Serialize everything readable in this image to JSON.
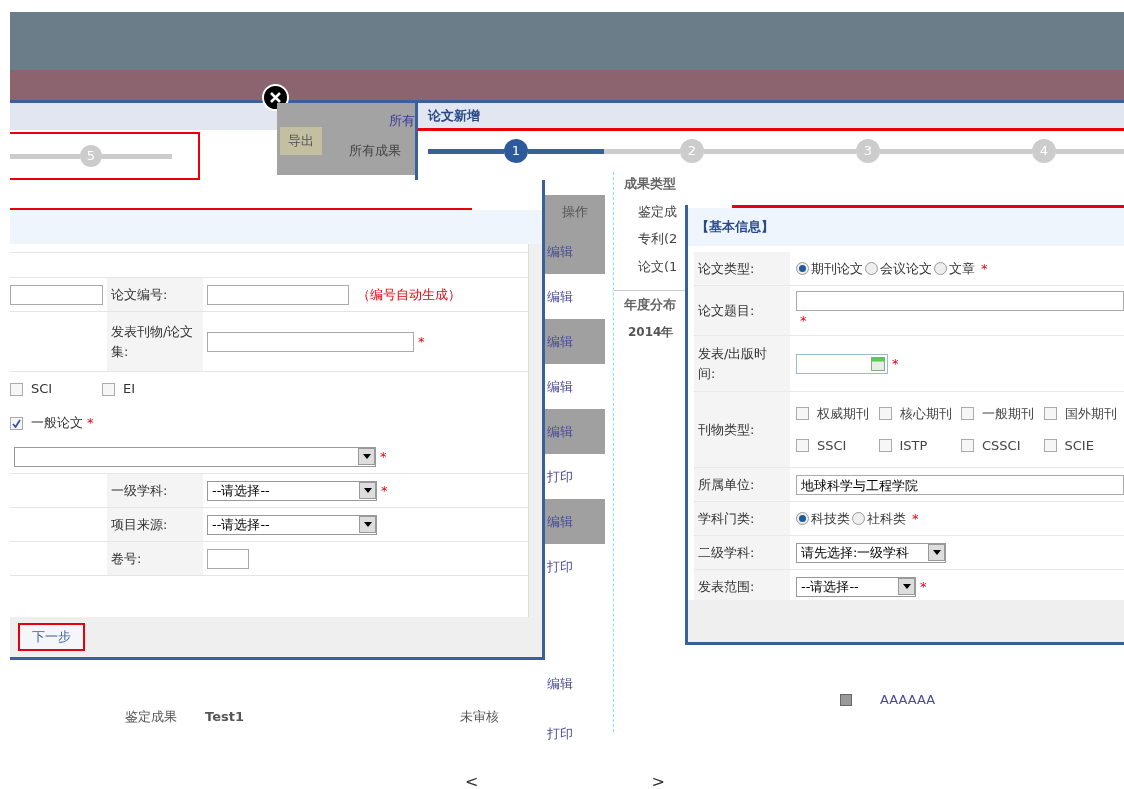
{
  "results_page": {
    "export_button": "导出",
    "filter_all": "所有成果",
    "filter_all_cut": "所有",
    "actions_header": "操作",
    "action_links": [
      "编辑",
      "编辑",
      "编辑",
      "编辑",
      "编辑",
      "打印",
      "编辑",
      "打印"
    ],
    "type_panel": {
      "title": "成果类型",
      "items": [
        "鉴定成",
        "专利(2",
        "论文(1"
      ]
    },
    "year_panel": {
      "title": "年度分布",
      "items": [
        "2014年"
      ]
    },
    "bottom_row": {
      "type": "鉴定成果",
      "name": "Test1",
      "status": "未审核",
      "links": [
        "编辑",
        "打印"
      ]
    },
    "bottom_right": {
      "text": "AAAAAA"
    }
  },
  "left_dialog": {
    "step": {
      "number": "5"
    },
    "rows": [
      {
        "kind": "input_note",
        "label": "论文编号:",
        "note": "（编号自动生成）"
      },
      {
        "kind": "input",
        "label": "发表刊物/论文集:",
        "required": "*"
      },
      {
        "kind": "checks",
        "items": [
          {
            "label": "SCI",
            "checked": false
          },
          {
            "label": "EI",
            "checked": false
          }
        ]
      },
      {
        "kind": "checks",
        "items": [
          {
            "label": "一般论文",
            "checked": true
          }
        ],
        "required": "*"
      },
      {
        "kind": "select",
        "value": "",
        "required": "*"
      },
      {
        "kind": "select",
        "label": "一级学科:",
        "value": "--请选择--",
        "required": "*"
      },
      {
        "kind": "select",
        "label": "项目来源:",
        "value": "--请选择--"
      },
      {
        "kind": "input",
        "label": "卷号:"
      }
    ],
    "next_button": "下一步"
  },
  "right_dialog": {
    "title": "论文新增",
    "steps": [
      {
        "number": "1",
        "selected": true
      },
      {
        "number": "2",
        "selected": false
      },
      {
        "number": "3",
        "selected": false
      },
      {
        "number": "4",
        "selected": false
      }
    ]
  },
  "basic_info_form": {
    "section": "【基本信息】",
    "rows": [
      {
        "kind": "radios",
        "label": "论文类型:",
        "required": "*",
        "options": [
          {
            "label": "期刊论文",
            "selected": true
          },
          {
            "label": "会议论文",
            "selected": false
          },
          {
            "label": "文章",
            "selected": false
          }
        ]
      },
      {
        "kind": "text",
        "label": "论文题目:",
        "required": "*"
      },
      {
        "kind": "date",
        "label": "发表/出版时间:",
        "required": "*"
      },
      {
        "kind": "checks",
        "label": "刊物类型:",
        "items": [
          {
            "label": "权威期刊",
            "checked": false
          },
          {
            "label": "核心期刊",
            "checked": false
          },
          {
            "label": "一般期刊",
            "checked": false
          },
          {
            "label": "国外期刊",
            "checked": false
          },
          {
            "label": "SSCI",
            "checked": false
          },
          {
            "label": "ISTP",
            "checked": false
          },
          {
            "label": "CSSCI",
            "checked": false
          },
          {
            "label": "SCIE",
            "checked": false
          }
        ]
      },
      {
        "kind": "value",
        "label": "所属单位:",
        "value": "地球科学与工程学院"
      },
      {
        "kind": "radios",
        "label": "学科门类:",
        "required": "*",
        "options": [
          {
            "label": "科技类",
            "selected": true
          },
          {
            "label": "社科类",
            "selected": false
          }
        ]
      },
      {
        "kind": "select",
        "label": "二级学科:",
        "value": "请先选择:一级学科"
      },
      {
        "kind": "select",
        "label": "发表范围:",
        "value": "--请选择--",
        "required": "*"
      }
    ]
  },
  "pager": {
    "prev": "<",
    "next": ">"
  }
}
